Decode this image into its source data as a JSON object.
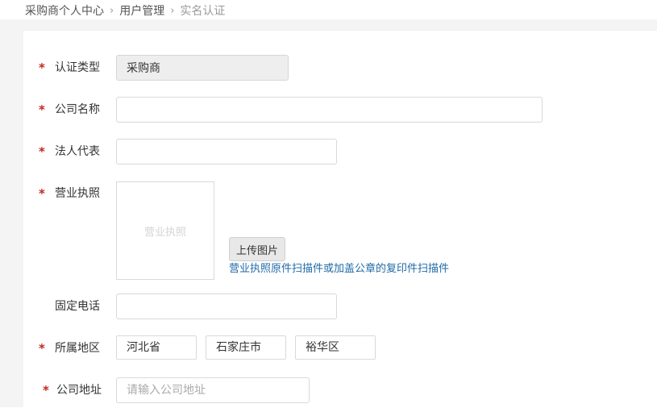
{
  "breadcrumb": {
    "items": [
      "采购商个人中心",
      "用户管理"
    ],
    "current": "实名认证",
    "separator": "›"
  },
  "form": {
    "required_mark": "*",
    "cert_type": {
      "label": "认证类型",
      "value": "采购商"
    },
    "company_name": {
      "label": "公司名称",
      "value": ""
    },
    "legal_rep": {
      "label": "法人代表",
      "value": ""
    },
    "license": {
      "label": "营业执照",
      "placeholder_text": "营业执照",
      "upload_button": "上传图片",
      "hint": "营业执照原件扫描件或加盖公章的复印件扫描件"
    },
    "phone": {
      "label": "固定电话",
      "value": ""
    },
    "region": {
      "label": "所属地区",
      "province": "河北省",
      "city": "石家庄市",
      "district": "裕华区"
    },
    "address": {
      "label": "公司地址",
      "value": "",
      "placeholder": "请输入公司地址"
    }
  },
  "colors": {
    "required": "#c0281e",
    "link": "#1f6aa8",
    "disabled_bg": "#eeeeee"
  }
}
